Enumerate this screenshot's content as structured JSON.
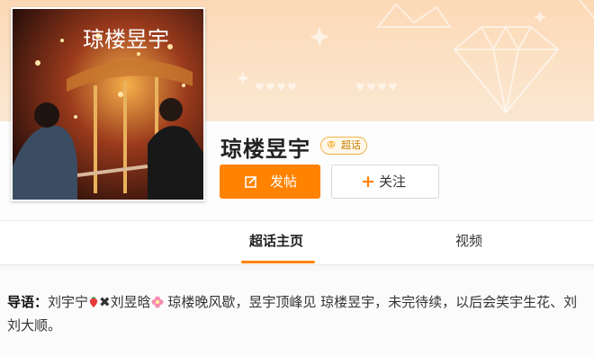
{
  "header": {
    "title": "琼楼昱宇",
    "badge_label": "超话",
    "cover_text": "琼楼昱宇",
    "brand_color": "#ff8200"
  },
  "actions": {
    "post_label": "发帖",
    "follow_label": "关注",
    "post_icon": "edit-icon",
    "follow_icon": "plus-icon"
  },
  "tabs": [
    {
      "label": "超话主页",
      "active": true
    },
    {
      "label": "视频",
      "active": false
    }
  ],
  "guide": {
    "label": "导语：",
    "text_1": "刘宇宁",
    "sep_icon": "✖",
    "text_2": "刘昱晗",
    "text_3": "琼楼晚风歇，昱宇顶峰见 琼楼昱宇，未完待续，以后会笑宇生花、刘刘大顺。"
  }
}
